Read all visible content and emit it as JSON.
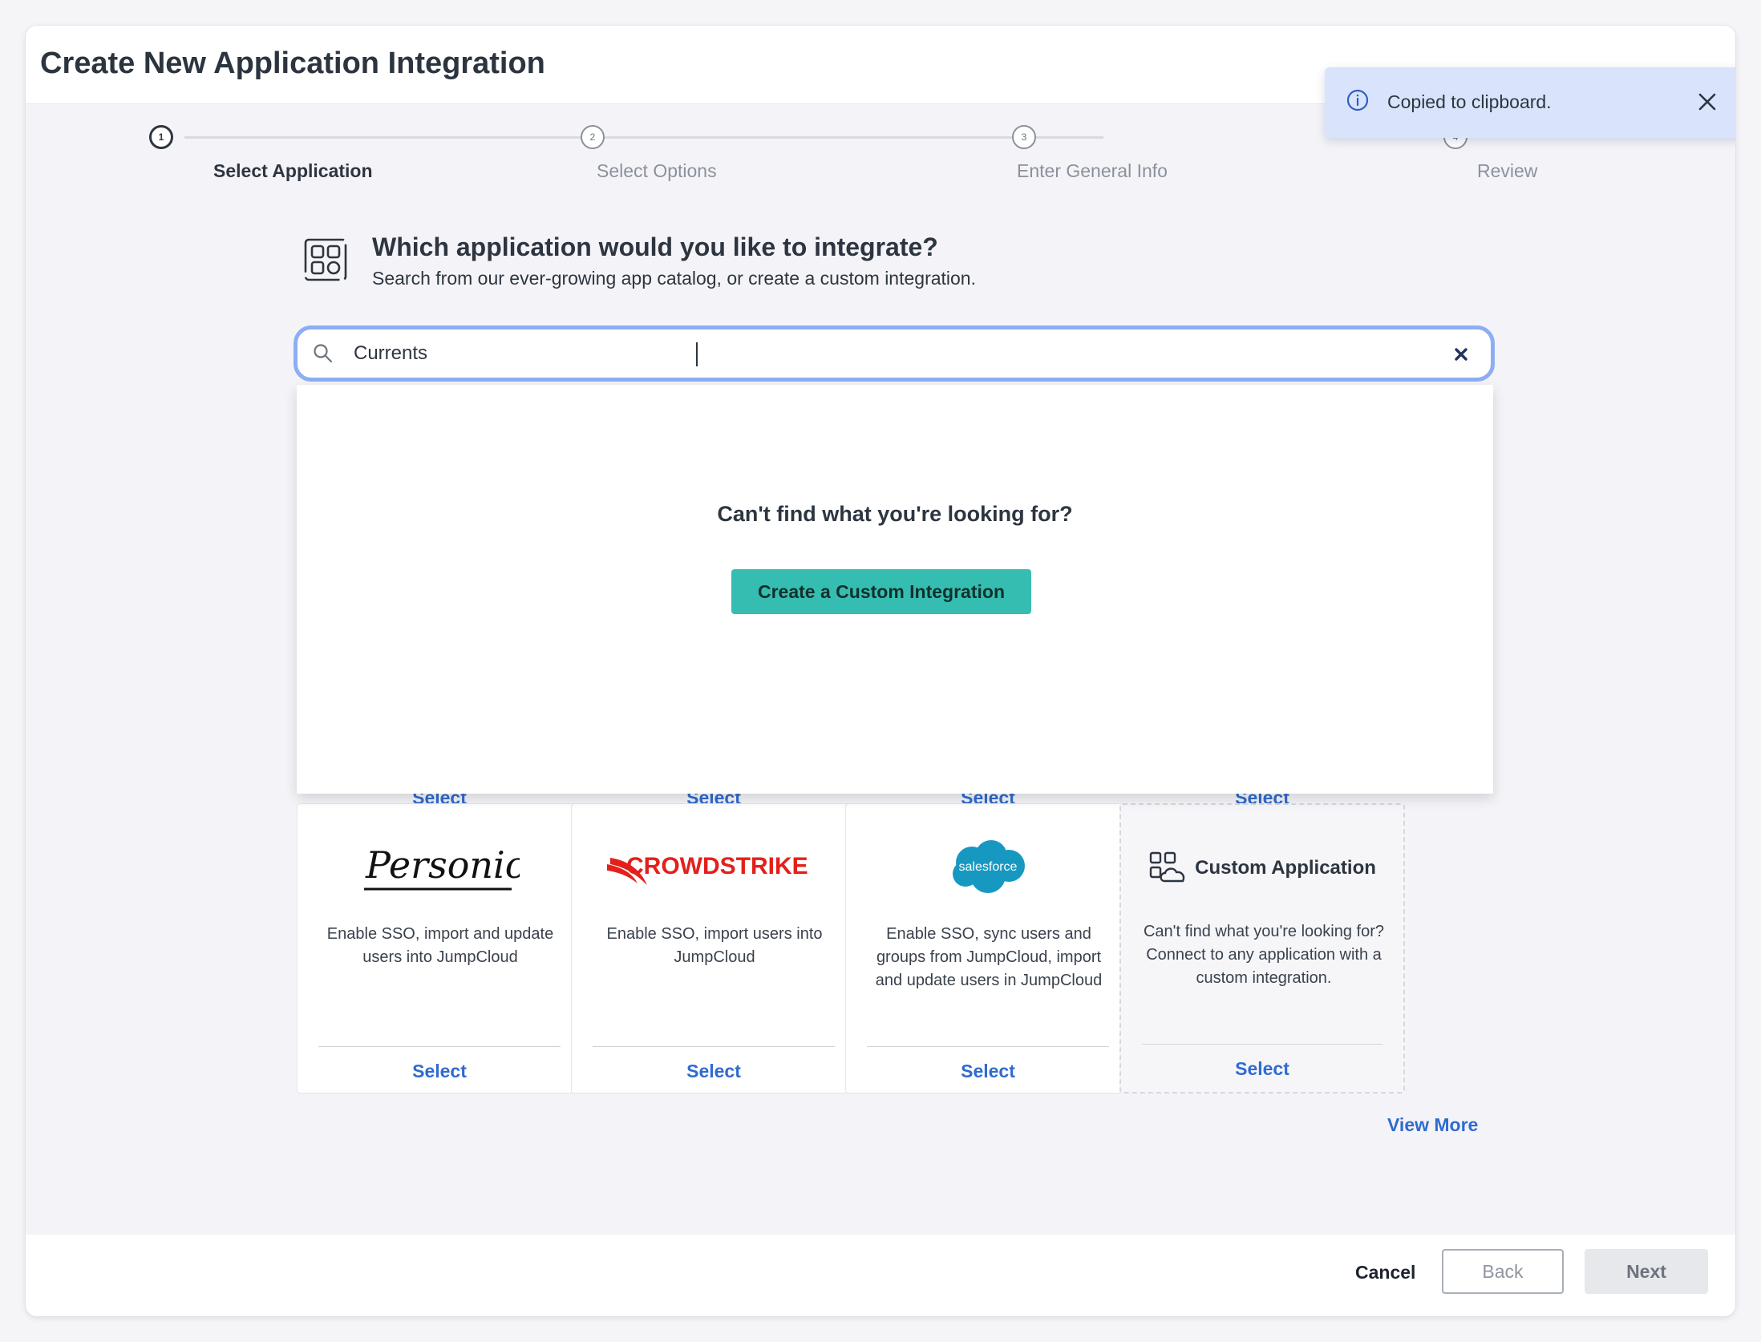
{
  "modal": {
    "title": "Create New Application Integration"
  },
  "toast": {
    "message": "Copied to clipboard.",
    "icon": "info-icon",
    "close_icon": "close-icon"
  },
  "stepper": {
    "steps": [
      {
        "number": "1",
        "label": "Select Application",
        "active": true
      },
      {
        "number": "2",
        "label": "Select Options",
        "active": false
      },
      {
        "number": "3",
        "label": "Enter General Info",
        "active": false
      },
      {
        "number": "4",
        "label": "Review",
        "active": false
      }
    ]
  },
  "intro": {
    "heading": "Which application would you like to integrate?",
    "subheading": "Search from our ever-growing app catalog, or create a custom integration."
  },
  "search": {
    "value": "Currents",
    "icon": "search-icon"
  },
  "dropdown": {
    "message": "Can't find what you're looking for?",
    "create_label": "Create a Custom Integration"
  },
  "cards": [
    {
      "logo": "Personio",
      "description": "Enable SSO, import and update users into JumpCloud",
      "select_label": "Select"
    },
    {
      "logo": "CROWDSTRIKE",
      "description": "Enable SSO, import users into JumpCloud",
      "select_label": "Select"
    },
    {
      "logo": "salesforce",
      "description": "Enable SSO, sync users and groups from JumpCloud, import and update users in JumpCloud",
      "select_label": "Select"
    },
    {
      "logo": "Custom Application",
      "description": "Can't find what you're looking for? Connect to any application with a custom integration.",
      "select_label": "Select"
    }
  ],
  "ghost_select_label": "Select",
  "view_more": "View More",
  "footer": {
    "cancel": "Cancel",
    "back": "Back",
    "next": "Next"
  },
  "colors": {
    "accent": "#36bdb1",
    "link": "#2f6bd0",
    "toast_bg": "#d9e4fc",
    "search_focus": "#8caef3",
    "crowdstrike_red": "#e3201b",
    "salesforce_blue": "#1798c1"
  }
}
